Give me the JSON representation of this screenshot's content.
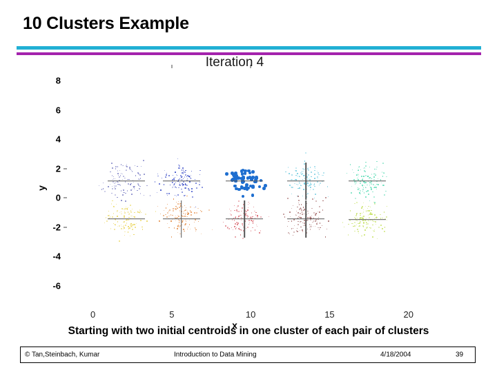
{
  "slide": {
    "title": "10 Clusters Example",
    "caption": "Starting with two initial centroids in one cluster of each pair of clusters",
    "rule_colors": {
      "top": "#21b0d4",
      "bottom": "#a423ad"
    }
  },
  "footer": {
    "copyright": "© Tan,Steinbach, Kumar",
    "book_title": "Introduction to Data Mining",
    "date": "4/18/2004",
    "page": "39"
  },
  "chart_data": {
    "type": "scatter",
    "title": "Iteration 4",
    "xlabel": "x",
    "ylabel": "y",
    "xlim": [
      -1.6,
      22.9
    ],
    "ylim": [
      -7.2,
      8.8
    ],
    "xticks": [
      0,
      5,
      10,
      15,
      20
    ],
    "xtick_labels": [
      "0",
      "5",
      "10",
      "15",
      "20"
    ],
    "yticks": [
      8,
      6,
      4,
      2,
      0,
      -2,
      -4,
      -6
    ],
    "ytick_labels": [
      "8",
      "6",
      "4",
      "2",
      "0",
      "-2",
      "-4",
      "-6"
    ],
    "grid": false,
    "legend": null,
    "description": "K-means iteration 4 on 10 gaussian clusters arranged as 5 vertical pairs; each pair shares one region of x. Cluster centroids are drawn as cross/line markers.",
    "series": [
      {
        "name": "cluster-1-slate",
        "color": "#7b7ec4",
        "marker": "small-dot",
        "center": [
          2.1,
          1.2
        ],
        "spread": [
          1.5,
          1.3
        ],
        "n": 110,
        "centroid": [
          2.1,
          1.15
        ],
        "centroid_marker": "horizontal-bar"
      },
      {
        "name": "cluster-2-gold",
        "color": "#e8d14a",
        "marker": "small-dot",
        "center": [
          2.1,
          -1.4
        ],
        "spread": [
          1.5,
          1.3
        ],
        "n": 110,
        "centroid": [
          2.1,
          -1.45
        ],
        "centroid_marker": "horizontal-bar"
      },
      {
        "name": "cluster-3-blue",
        "color": "#2b3fc4",
        "marker": "small-dot",
        "center": [
          5.6,
          1.2
        ],
        "spread": [
          1.4,
          1.3
        ],
        "n": 120,
        "centroid": [
          5.6,
          1.15
        ],
        "centroid_marker": "horizontal-bar"
      },
      {
        "name": "cluster-4-orange",
        "color": "#e2853a",
        "marker": "small-dot",
        "center": [
          5.6,
          -1.4
        ],
        "spread": [
          1.4,
          1.3
        ],
        "n": 120,
        "centroid": [
          5.6,
          -1.45
        ],
        "centroid_marker": "cross"
      },
      {
        "name": "cluster-5-brightblue",
        "color": "#1f6fd0",
        "marker": "filled-circle",
        "center": [
          9.6,
          1.2
        ],
        "spread": [
          1.2,
          1.0
        ],
        "n": 60,
        "centroid": [
          9.6,
          1.15
        ],
        "centroid_marker": "horizontal-bar"
      },
      {
        "name": "cluster-6-red",
        "color": "#d9616a",
        "marker": "small-dot",
        "center": [
          9.6,
          -1.4
        ],
        "spread": [
          1.3,
          1.3
        ],
        "n": 120,
        "centroid": [
          9.6,
          -1.45
        ],
        "centroid_marker": "cross"
      },
      {
        "name": "cluster-7-cyan",
        "color": "#63c6dd",
        "marker": "small-dot",
        "center": [
          13.5,
          1.2
        ],
        "spread": [
          1.3,
          1.3
        ],
        "n": 120,
        "centroid": [
          13.5,
          1.15
        ],
        "centroid_marker": "cross"
      },
      {
        "name": "cluster-8-maroon",
        "color": "#9d5c5c",
        "marker": "small-dot",
        "center": [
          13.5,
          -1.4
        ],
        "spread": [
          1.3,
          1.4
        ],
        "n": 130,
        "centroid": [
          13.5,
          -1.45
        ],
        "centroid_marker": "cross"
      },
      {
        "name": "cluster-9-springgreen",
        "color": "#4fd9b0",
        "marker": "small-dot",
        "center": [
          17.4,
          1.2
        ],
        "spread": [
          1.3,
          1.4
        ],
        "n": 130,
        "centroid": [
          17.4,
          1.15
        ],
        "centroid_marker": "horizontal-bar"
      },
      {
        "name": "cluster-10-yellowgreen",
        "color": "#c3e05a",
        "marker": "small-dot",
        "center": [
          17.4,
          -1.5
        ],
        "spread": [
          1.3,
          1.3
        ],
        "n": 120,
        "centroid": [
          17.4,
          -1.5
        ],
        "centroid_marker": "horizontal-bar"
      }
    ]
  }
}
